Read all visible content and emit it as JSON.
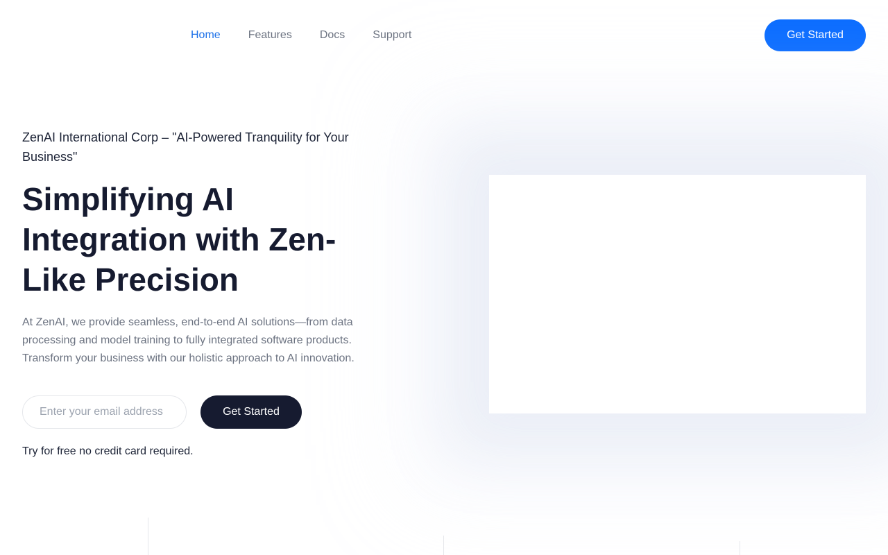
{
  "nav": {
    "items": [
      {
        "label": "Home",
        "active": true
      },
      {
        "label": "Features",
        "active": false
      },
      {
        "label": "Docs",
        "active": false
      },
      {
        "label": "Support",
        "active": false
      }
    ],
    "cta_label": "Get Started"
  },
  "hero": {
    "tagline": "ZenAI International Corp – \"AI-Powered Tranquility for Your Business\"",
    "headline": "Simplifying AI Integration with Zen-Like Precision",
    "description": "At ZenAI, we provide seamless, end-to-end AI solutions—from data processing and model training to fully integrated software products. Transform your business with our holistic approach to AI innovation.",
    "email_placeholder": "Enter your email address",
    "email_value": "",
    "cta_label": "Get Started",
    "note": "Try for free no credit card required."
  },
  "colors": {
    "accent": "#0a6cff",
    "dark": "#161b30",
    "muted": "#6b7280",
    "active_nav": "#1a6fe8"
  }
}
